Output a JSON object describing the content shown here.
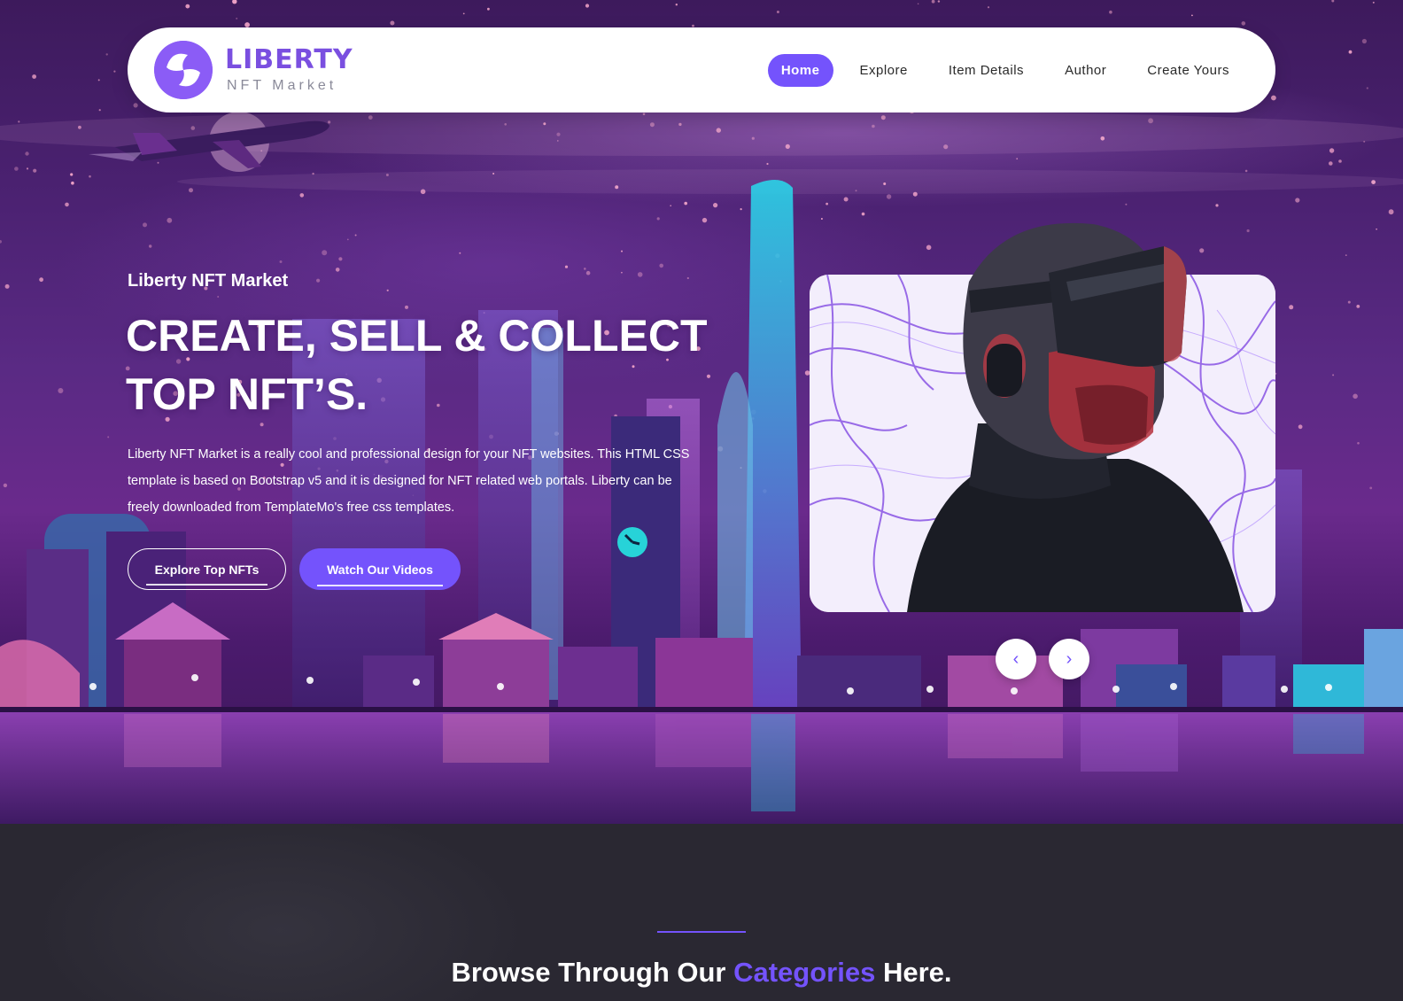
{
  "nav": {
    "logo_title": "LIBERTY",
    "logo_subtitle": "NFT Market",
    "links": [
      {
        "label": "Home",
        "active": true
      },
      {
        "label": "Explore",
        "active": false
      },
      {
        "label": "Item Details",
        "active": false
      },
      {
        "label": "Author",
        "active": false
      },
      {
        "label": "Create Yours",
        "active": false
      }
    ]
  },
  "hero": {
    "eyebrow": "Liberty NFT Market",
    "title_line1": "CREATE, SELL & COLLECT",
    "title_line2": "TOP NFT’S.",
    "description": "Liberty NFT Market is a really cool and professional design for your NFT websites. This HTML CSS template is based on Bootstrap v5 and it is designed for NFT related web portals. Liberty can be freely downloaded from TemplateMo's free css templates.",
    "primary_button": "Explore Top NFTs",
    "secondary_button": "Watch Our Videos",
    "prev_arrow": "‹",
    "next_arrow": "›"
  },
  "categories": {
    "title_prefix": "Browse Through Our ",
    "title_accent": "Categories",
    "title_suffix": " Here."
  },
  "colors": {
    "accent": "#7453fc",
    "hero_bg": "#4a2170",
    "section_bg": "#2a2832",
    "white": "#ffffff"
  },
  "icons": {
    "logo": "liberty-logo-icon",
    "prev": "chevron-left-icon",
    "next": "chevron-right-icon"
  }
}
